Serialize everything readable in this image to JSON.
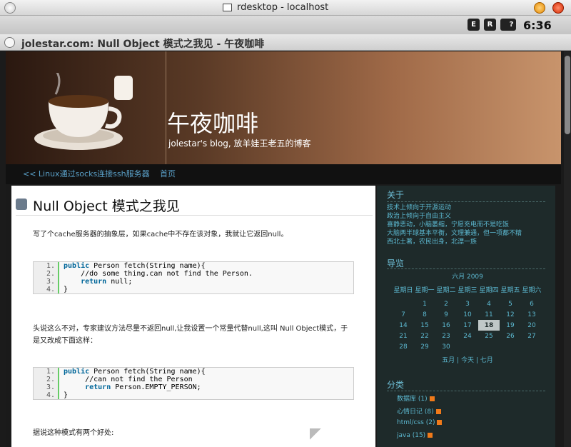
{
  "os_window": {
    "title": "rdesktop - localhost"
  },
  "status": {
    "time": "6:36 PM",
    "icons": [
      {
        "name": "keyboard-icon",
        "glyph": "E"
      },
      {
        "name": "signal-icon",
        "glyph": "R"
      },
      {
        "name": "battery-icon",
        "glyph": ""
      },
      {
        "name": "help-icon",
        "glyph": "?"
      }
    ]
  },
  "browser": {
    "title": "jolestar.com: Null Object 模式之我见 - 午夜咖啡"
  },
  "header": {
    "site_title": "午夜咖啡",
    "tagline": "jolestar's blog, 放羊娃王老五的博客"
  },
  "nav": {
    "prev": "<< Linux通过socks连接ssh服务器",
    "home": "首页"
  },
  "post": {
    "title": "Null Object 模式之我见",
    "para1": "写了个cache服务器的抽象层，如果cache中不存在该对象，我就让它返回null。",
    "para2": "头说这么不对，专家建议方法尽量不返回null,让我设置一个常量代替null,这叫 Null Object模式，于是又改成下面这样：",
    "para3": "据说这种模式有两个好处:",
    "code1": [
      {
        "n": "1.",
        "kw": "public",
        "rest": " Person fetch(String name){"
      },
      {
        "n": "2.",
        "cm": "    //do some thing.can not find the Person."
      },
      {
        "n": "3.",
        "kw": "    return",
        "rest": " null;"
      },
      {
        "n": "4.",
        "rest": "}"
      }
    ],
    "code2": [
      {
        "n": "1.",
        "kw": "public",
        "rest": " Person fetch(String name){"
      },
      {
        "n": "2.",
        "cm": "     //can not find the Person"
      },
      {
        "n": "3.",
        "kw": "     return",
        "rest": " Person.EMPTY_PERSON;"
      },
      {
        "n": "4.",
        "rest": "}"
      }
    ]
  },
  "sidebar": {
    "about_heading": "关于",
    "about_lines": [
      "技术上倾向于开源运动",
      "政治上倾向于自由主义",
      "喜静恶动，小脑萎缩，宁愿充电而不是吃饭",
      "大脑两半球基本平衡，文理兼通，但一项都不精",
      "西北土著，农民出身，北漂一族"
    ],
    "guide_heading": "导览",
    "calendar": {
      "caption": "六月 2009",
      "weekdays": [
        "星期日",
        "星期一",
        "星期二",
        "星期三",
        "星期四",
        "星期五",
        "星期六"
      ],
      "weeks": [
        [
          "",
          "1",
          "2",
          "3",
          "4",
          "5",
          "6"
        ],
        [
          "7",
          "8",
          "9",
          "10",
          "11",
          "12",
          "13"
        ],
        [
          "14",
          "15",
          "16",
          "17",
          "18",
          "19",
          "20"
        ],
        [
          "21",
          "22",
          "23",
          "24",
          "25",
          "26",
          "27"
        ],
        [
          "28",
          "29",
          "30",
          "",
          "",
          "",
          ""
        ]
      ],
      "today": "18",
      "nav_prev": "五月",
      "nav_today": "今天",
      "nav_next": "七月",
      "sep": "|"
    },
    "cat_heading": "分类",
    "categories": [
      "数据库 (1)",
      "心情日记 (8)",
      "html/css (2)",
      "java (15)"
    ]
  }
}
